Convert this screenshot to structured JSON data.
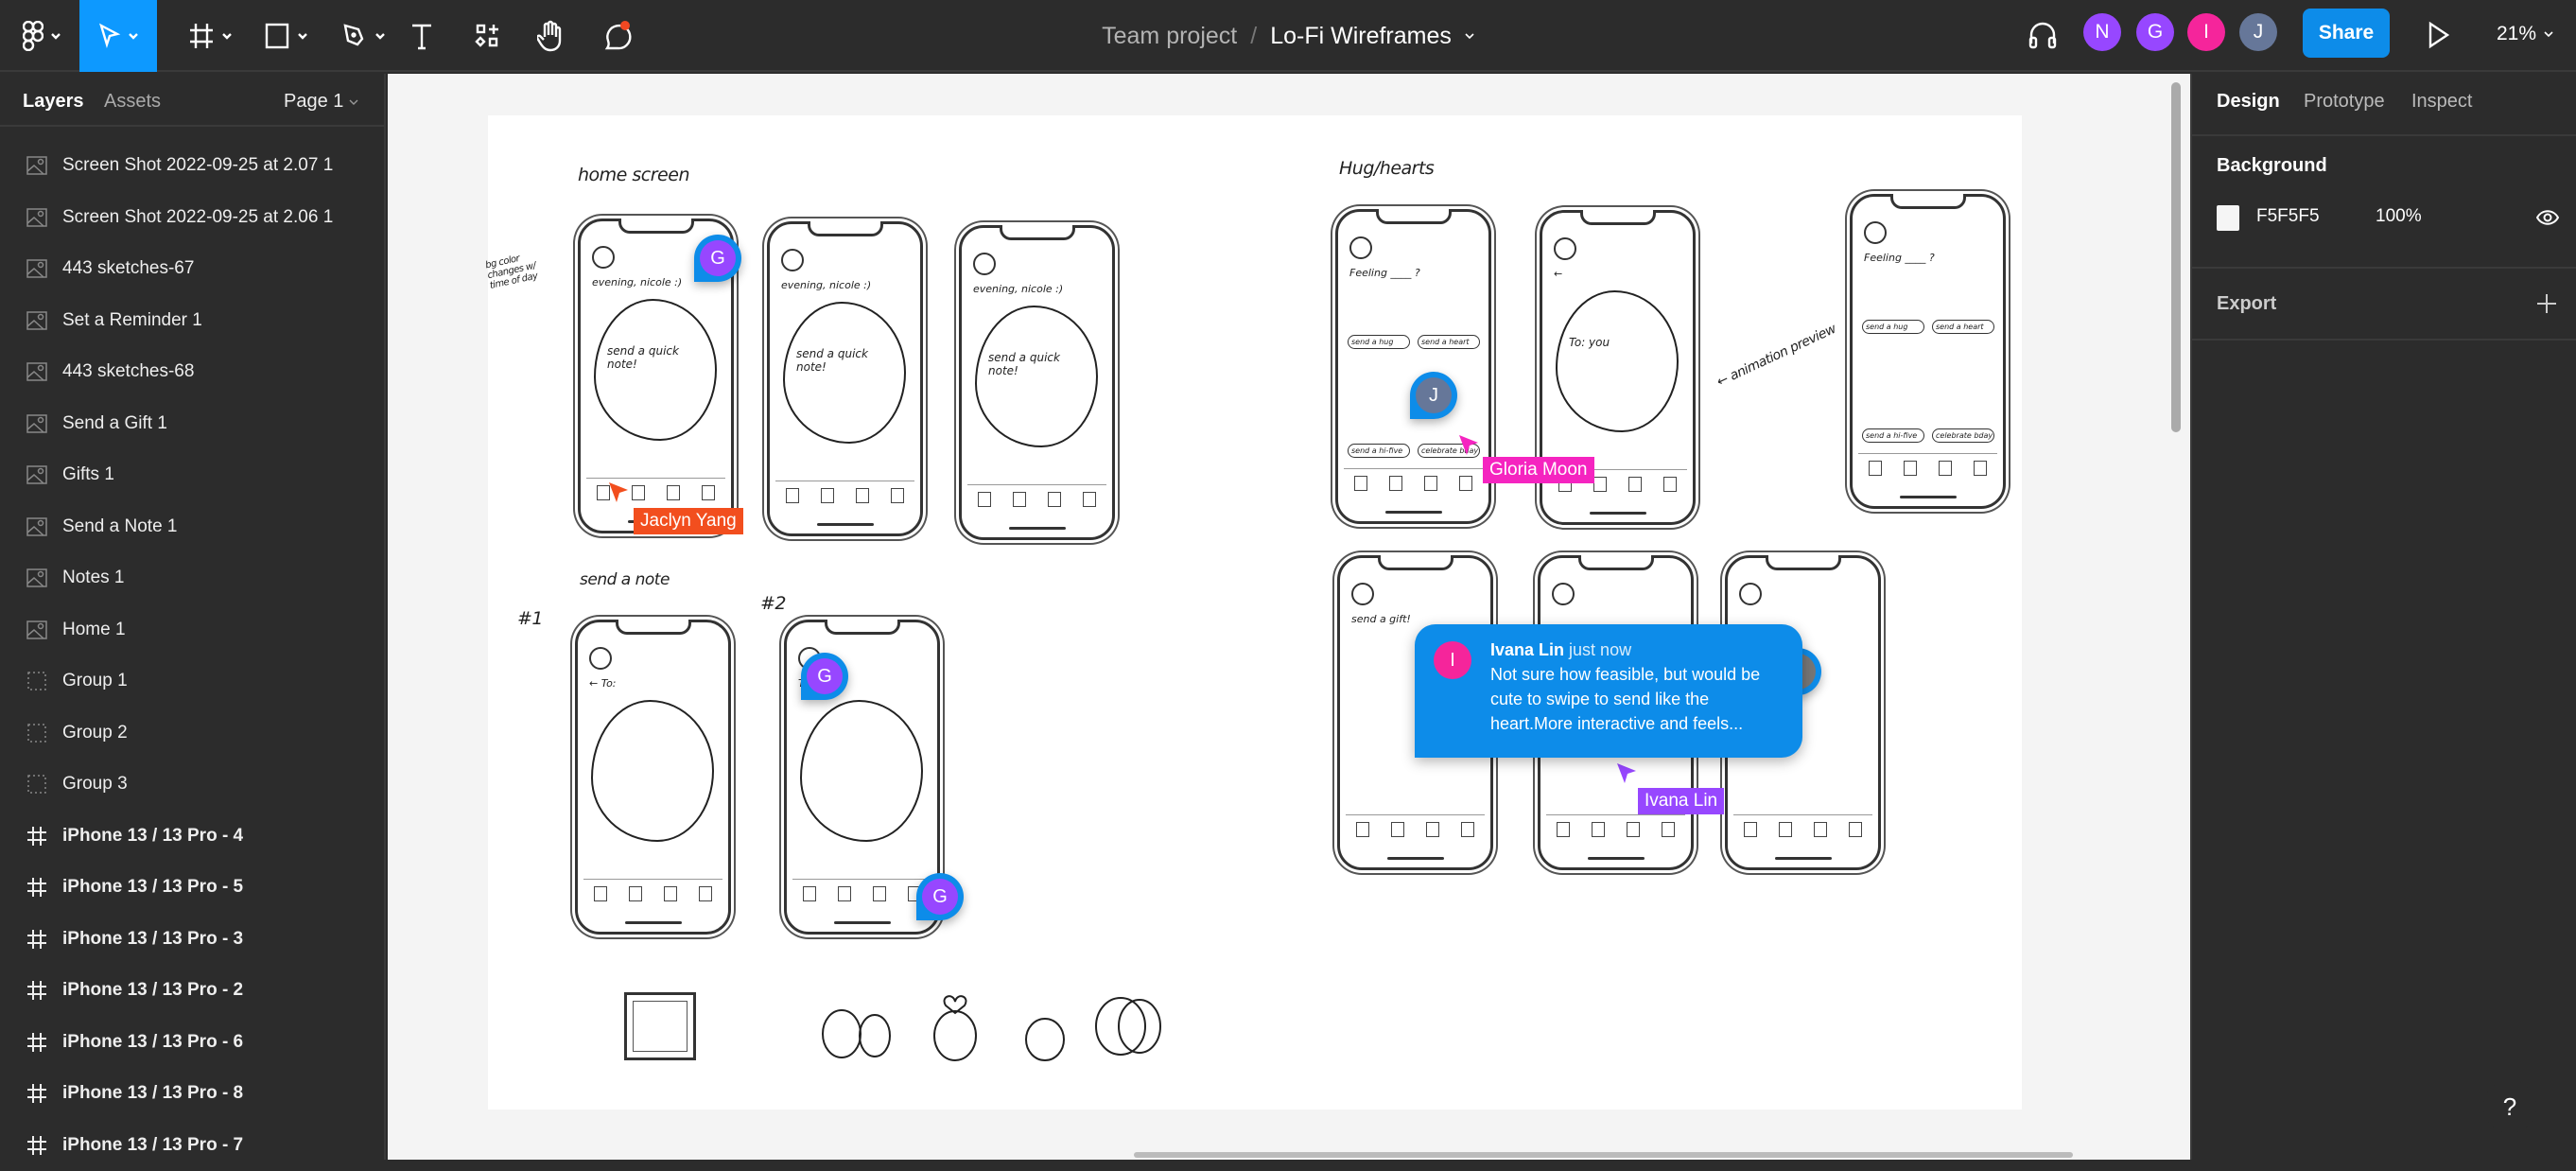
{
  "toolbar": {
    "tools": [
      "main-menu",
      "move",
      "frame",
      "shape",
      "pen",
      "text",
      "resources",
      "hand",
      "comment"
    ],
    "active_tool": "move"
  },
  "header": {
    "project": "Team project",
    "separator": "/",
    "file": "Lo-Fi Wireframes"
  },
  "collaborators": [
    {
      "initial": "N",
      "color": "#9747ff"
    },
    {
      "initial": "G",
      "color": "#9747ff"
    },
    {
      "initial": "I",
      "color": "#f5259b"
    },
    {
      "initial": "J",
      "color": "#667799"
    }
  ],
  "share_label": "Share",
  "zoom_level": "21%",
  "left_panel": {
    "tabs": [
      "Layers",
      "Assets"
    ],
    "page": "Page 1",
    "layers": [
      {
        "label": "Screen Shot 2022-09-25 at 2.07 1",
        "type": "image"
      },
      {
        "label": "Screen Shot 2022-09-25 at 2.06 1",
        "type": "image"
      },
      {
        "label": "443 sketches-67",
        "type": "image"
      },
      {
        "label": "Set a Reminder 1",
        "type": "image"
      },
      {
        "label": "443 sketches-68",
        "type": "image"
      },
      {
        "label": "Send a Gift 1",
        "type": "image"
      },
      {
        "label": "Gifts 1",
        "type": "image"
      },
      {
        "label": "Send a Note 1",
        "type": "image"
      },
      {
        "label": "Notes 1",
        "type": "image"
      },
      {
        "label": "Home 1",
        "type": "image"
      },
      {
        "label": "Group 1",
        "type": "group"
      },
      {
        "label": "Group 2",
        "type": "group"
      },
      {
        "label": "Group 3",
        "type": "group"
      },
      {
        "label": "iPhone 13 / 13 Pro - 4",
        "type": "frame"
      },
      {
        "label": "iPhone 13 / 13 Pro - 5",
        "type": "frame"
      },
      {
        "label": "iPhone 13 / 13 Pro - 3",
        "type": "frame"
      },
      {
        "label": "iPhone 13 / 13 Pro - 2",
        "type": "frame"
      },
      {
        "label": "iPhone 13 / 13 Pro - 6",
        "type": "frame"
      },
      {
        "label": "iPhone 13 / 13 Pro - 8",
        "type": "frame"
      },
      {
        "label": "iPhone 13 / 13 Pro - 7",
        "type": "frame"
      }
    ]
  },
  "right_panel": {
    "tabs": [
      "Design",
      "Prototype",
      "Inspect"
    ],
    "background_label": "Background",
    "background_hex": "F5F5F5",
    "background_opacity": "100%",
    "export_label": "Export"
  },
  "canvas": {
    "labels": {
      "home": "home screen",
      "hug": "Hug/hearts",
      "note": "send a note",
      "n1": "#1",
      "n2": "#2",
      "bg_note": "bg color changes w/ time of day",
      "anim": "← animation preview"
    },
    "phones": [
      {
        "text": "evening, nicole :)",
        "blob": "send a quick note!",
        "kind": "home"
      },
      {
        "text": "evening, nicole :)",
        "blob": "send a quick note!",
        "kind": "home"
      },
      {
        "text": "evening, nicole :)",
        "blob": "send a quick note!",
        "kind": "home"
      },
      {
        "text": "← To:",
        "blob": "",
        "kind": "note"
      },
      {
        "text": "To:",
        "blob": "",
        "kind": "note"
      },
      {
        "text": "Feeling ____ ?",
        "chips": [
          "send a hug",
          "send a heart",
          "send a hi-five",
          "celebrate bday"
        ],
        "kind": "hug"
      },
      {
        "text": "←",
        "blob": "To: you",
        "kind": "send"
      },
      {
        "text": "Feeling ____ ?",
        "chips": [
          "send a hug",
          "send a heart",
          "send a hi-five",
          "celebrate bday"
        ],
        "kind": "hug"
      },
      {
        "text": "send a gift!",
        "blob": "",
        "kind": "gift"
      },
      {
        "text": "",
        "blob": "",
        "kind": "gift"
      },
      {
        "text": "",
        "blob": "",
        "kind": "gift"
      }
    ],
    "cursors": [
      {
        "name": "Jaclyn Yang",
        "color": "#f24e1e"
      },
      {
        "name": "Gloria Moon",
        "color": "#f524c0"
      },
      {
        "name": "Ivana Lin",
        "color": "#9747ff"
      }
    ],
    "pins": [
      {
        "initial": "G",
        "color": "#9747ff"
      },
      {
        "initial": "J",
        "color": "#667799"
      },
      {
        "initial": "G",
        "color": "#9747ff"
      },
      {
        "initial": "G",
        "color": "#9747ff"
      }
    ],
    "comment": {
      "author": "Ivana Lin",
      "time": "just now",
      "initial": "I",
      "text": "Not sure how feasible, but would be cute to swipe to send like the heart.More interactive and feels..."
    }
  },
  "help_label": "?"
}
